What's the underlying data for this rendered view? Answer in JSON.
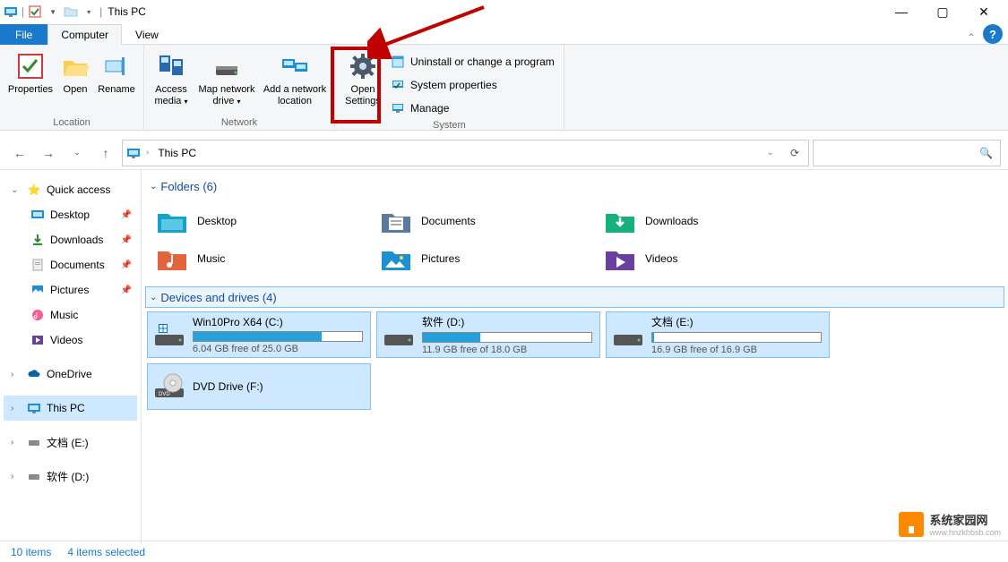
{
  "titlebar": {
    "title": "This PC"
  },
  "tabs": {
    "file": "File",
    "computer": "Computer",
    "view": "View"
  },
  "ribbon": {
    "location": {
      "properties": "Properties",
      "open": "Open",
      "rename": "Rename",
      "group": "Location"
    },
    "network": {
      "access_media": "Access media",
      "map_drive": "Map network drive",
      "add_loc": "Add a network location",
      "group": "Network"
    },
    "settings": {
      "open_settings_l1": "Open",
      "open_settings_l2": "Settings"
    },
    "system": {
      "uninstall": "Uninstall or change a program",
      "sys_props": "System properties",
      "manage": "Manage",
      "group": "System"
    }
  },
  "addr": {
    "crumb1": "This PC"
  },
  "sidebar": {
    "quick": "Quick access",
    "desktop": "Desktop",
    "downloads": "Downloads",
    "documents": "Documents",
    "pictures": "Pictures",
    "music": "Music",
    "videos": "Videos",
    "onedrive": "OneDrive",
    "thispc": "This PC",
    "drive_e": "文档 (E:)",
    "drive_d": "软件 (D:)"
  },
  "sections": {
    "folders_hdr": "Folders (6)",
    "drives_hdr": "Devices and drives (4)"
  },
  "folders": {
    "desktop": "Desktop",
    "documents": "Documents",
    "downloads": "Downloads",
    "music": "Music",
    "pictures": "Pictures",
    "videos": "Videos"
  },
  "drives": {
    "c": {
      "name": "Win10Pro X64 (C:)",
      "free": "6.04 GB free of 25.0 GB",
      "pct": 76
    },
    "d": {
      "name": "软件 (D:)",
      "free": "11.9 GB free of 18.0 GB",
      "pct": 34
    },
    "e": {
      "name": "文档 (E:)",
      "free": "16.9 GB free of 16.9 GB",
      "pct": 1
    },
    "f": {
      "name": "DVD Drive (F:)"
    }
  },
  "status": {
    "items": "10 items",
    "selected": "4 items selected"
  },
  "watermark": {
    "text": "系统家园网",
    "url": "www.hnzkhbsb.com"
  }
}
